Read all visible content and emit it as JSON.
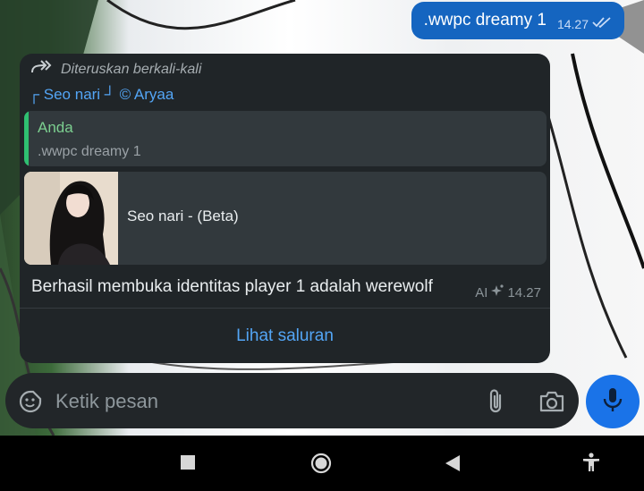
{
  "outgoing": {
    "text": ".wwpc dreamy 1",
    "time": "14.27"
  },
  "forwarded": {
    "label": "Diteruskan berkali-kali",
    "channel": "┌ Seo nari ┘ © Aryaa",
    "quote": {
      "name": "Anda",
      "text": ".wwpc dreamy 1"
    },
    "preview": {
      "title": "Seo nari - (Beta)"
    },
    "message": "Berhasil membuka identitas player 1 adalah werewolf",
    "meta": {
      "ai": "AI",
      "time": "14.27"
    },
    "action": "Lihat saluran"
  },
  "composer": {
    "placeholder": "Ketik pesan"
  },
  "icons": [
    "forward-icon",
    "double-check-icon",
    "sparkle-icon",
    "emoji-icon",
    "attach-icon",
    "camera-icon",
    "mic-icon",
    "nav-recents-icon",
    "nav-home-icon",
    "nav-back-icon",
    "accessibility-icon"
  ],
  "colors": {
    "accent": "#1565c0",
    "link": "#53a5f5",
    "quote_bar": "#2fbf71",
    "quote_name": "#7ccf90",
    "card_bg": "#202528"
  }
}
